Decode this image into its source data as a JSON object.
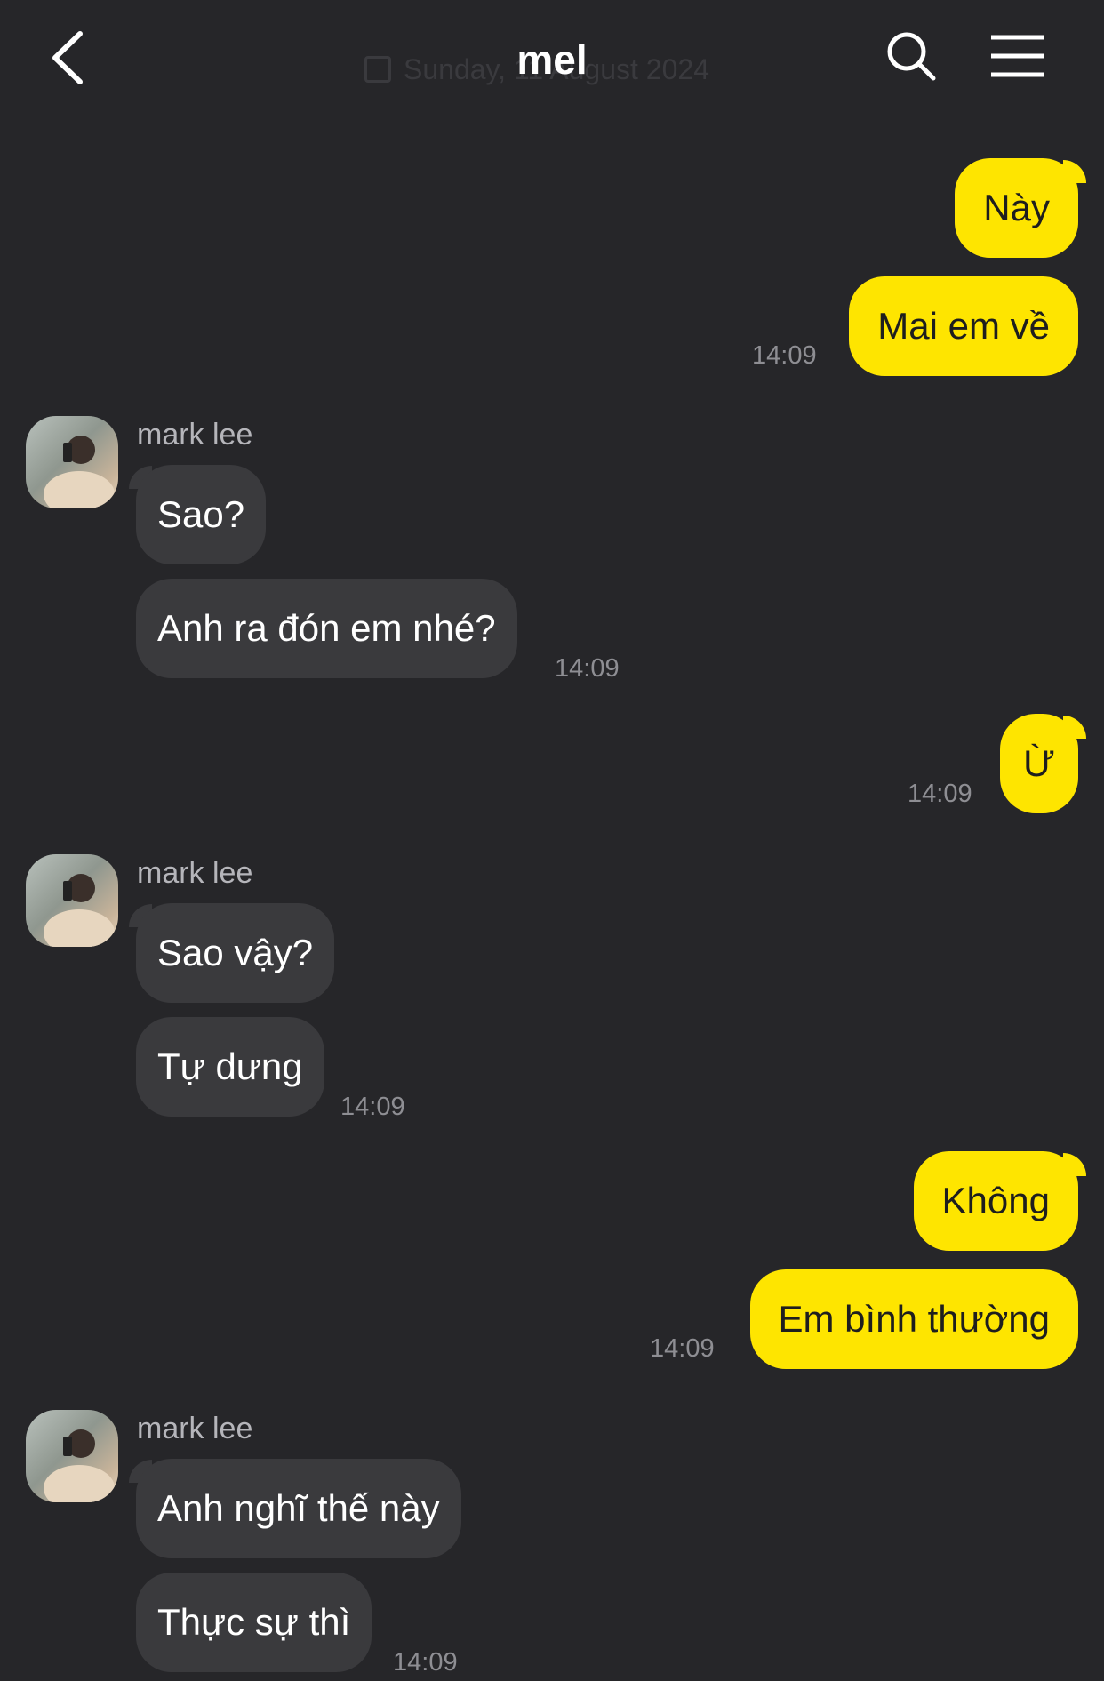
{
  "header": {
    "title": "mel",
    "date_banner": "Sunday, 11 August 2024"
  },
  "icons": {
    "back": "chevron-left-icon",
    "search": "search-icon",
    "menu": "hamburger-menu-icon",
    "calendar": "calendar-icon"
  },
  "colors": {
    "background": "#262629",
    "my_bubble": "#fee500",
    "their_bubble": "#3a3a3d",
    "timestamp": "#8e8e93"
  },
  "messages": [
    {
      "from": "me",
      "text": "Này"
    },
    {
      "from": "me",
      "text": "Mai em về",
      "time": "14:09"
    },
    {
      "from": "them",
      "sender": "mark lee",
      "text": "Sao?"
    },
    {
      "from": "them",
      "text": "Anh ra đón em nhé?",
      "time": "14:09"
    },
    {
      "from": "me",
      "text": "Ừ",
      "time": "14:09"
    },
    {
      "from": "them",
      "sender": "mark lee",
      "text": "Sao vậy?"
    },
    {
      "from": "them",
      "text": "Tự dưng",
      "time": "14:09"
    },
    {
      "from": "me",
      "text": "Không"
    },
    {
      "from": "me",
      "text": "Em bình thường",
      "time": "14:09"
    },
    {
      "from": "them",
      "sender": "mark lee",
      "text": "Anh nghĩ thế này"
    },
    {
      "from": "them",
      "text": "Thực sự thì",
      "time": "14:09"
    }
  ]
}
